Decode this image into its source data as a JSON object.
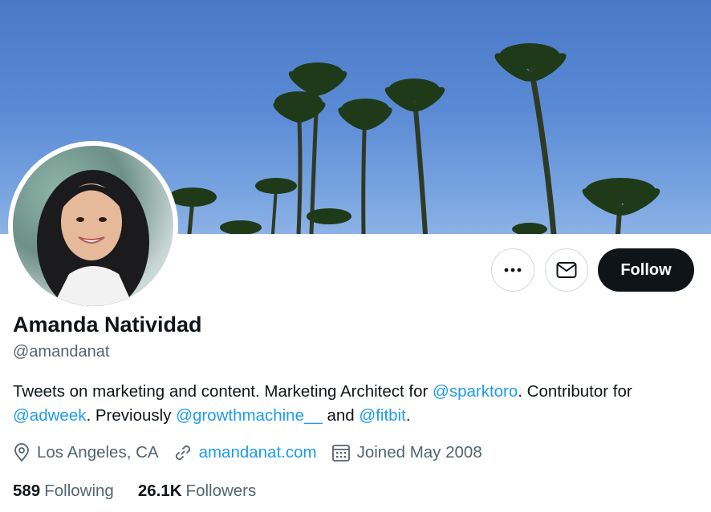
{
  "profile": {
    "name": "Amanda Natividad",
    "handle": "@amandanat",
    "bio": {
      "part1": "Tweets on marketing and content. Marketing Architect for ",
      "mention1": "@sparktoro",
      "part2": ". Contributor for ",
      "mention2": "@adweek",
      "part3": ". Previously ",
      "mention3": "@growthmachine__",
      "part4": " and ",
      "mention4": "@fitbit",
      "part5": "."
    },
    "location": "Los Angeles, CA",
    "website": "amandanat.com",
    "joined": "Joined May 2008",
    "following_count": "589",
    "following_label": "Following",
    "followers_count": "26.1K",
    "followers_label": "Followers"
  },
  "actions": {
    "follow_label": "Follow"
  },
  "icons": {
    "more": "more-dots-icon",
    "message": "envelope-icon",
    "location": "location-pin-icon",
    "link": "link-icon",
    "calendar": "calendar-icon"
  },
  "colors": {
    "accent": "#1d9bf0",
    "text": "#0f1419",
    "secondary": "#536471",
    "follow_bg": "#0f1419"
  }
}
